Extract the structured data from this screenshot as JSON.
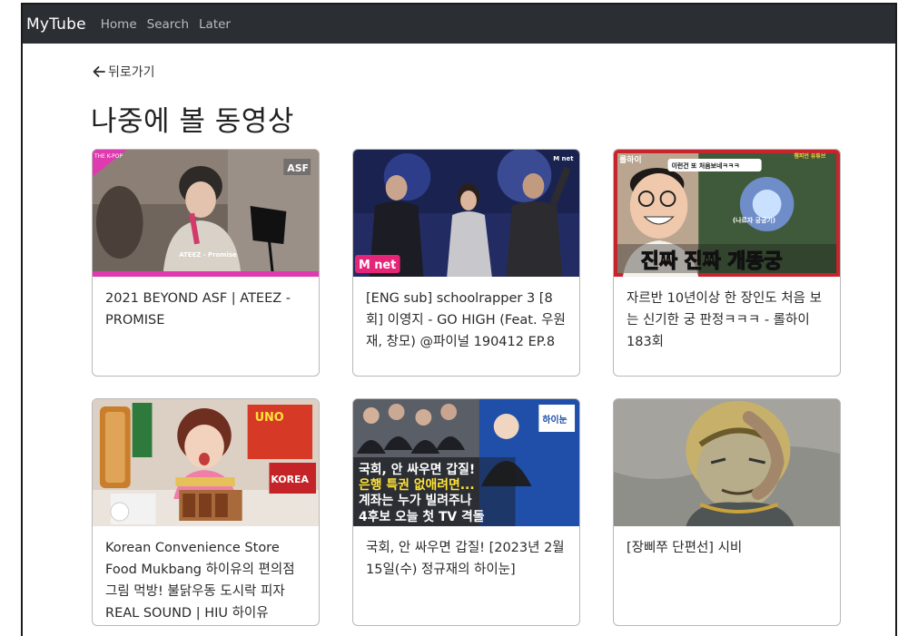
{
  "navbar": {
    "brand": "MyTube",
    "links": [
      "Home",
      "Search",
      "Later"
    ]
  },
  "back_link": "뒤로가기",
  "page_title": "나중에 볼 동영상",
  "videos": [
    {
      "title": "2021 BEYOND ASF | ATEEZ - PROMISE",
      "thumb_text": [
        "THE K-POP",
        "ASF",
        "ATEEZ - Promise"
      ]
    },
    {
      "title": "[ENG sub] schoolrapper 3 [8회] 이영지 - GO HIGH (Feat. 우원재, 창모) @파이널 190412 EP.8",
      "thumb_text": [
        "M net",
        "M net"
      ]
    },
    {
      "title": "자르반 10년이상 한 장인도 처음 보는 신기한 궁 판정ㅋㅋㅋ - 롤하이 183회",
      "thumb_text": [
        "롤하이",
        "이런건 또 처음보네ㅋㅋㅋ",
        "챔피언 유튜브",
        "(나르자 궁궁기)",
        "진짜 진짜 개똥궁"
      ]
    },
    {
      "title": "Korean Convenience Store Food Mukbang 하이유의 편의점 그림 먹방! 불닭우동 도시락 피자 REAL SOUND | HIU 하이유",
      "thumb_text": [
        "UNO",
        "KOREA"
      ]
    },
    {
      "title": "국회, 안 싸우면 갑질! [2023년 2월 15일(수) 정규재의 하이눈]",
      "thumb_text": [
        "하이눈",
        "국회, 안 싸우면 갑질!",
        "은행 특권 없애려면...",
        "계좌는 누가 빌려주나",
        "4후보 오늘 첫 TV 격돌"
      ]
    },
    {
      "title": "[장삐쭈 단편선] 시비",
      "thumb_text": []
    }
  ],
  "colors": {
    "navbar_bg": "#2b2f33",
    "brand": "#ffffff",
    "nav_link": "#b9bcbf",
    "card_border": "#b8b8b8",
    "text": "#2a2a2a"
  }
}
